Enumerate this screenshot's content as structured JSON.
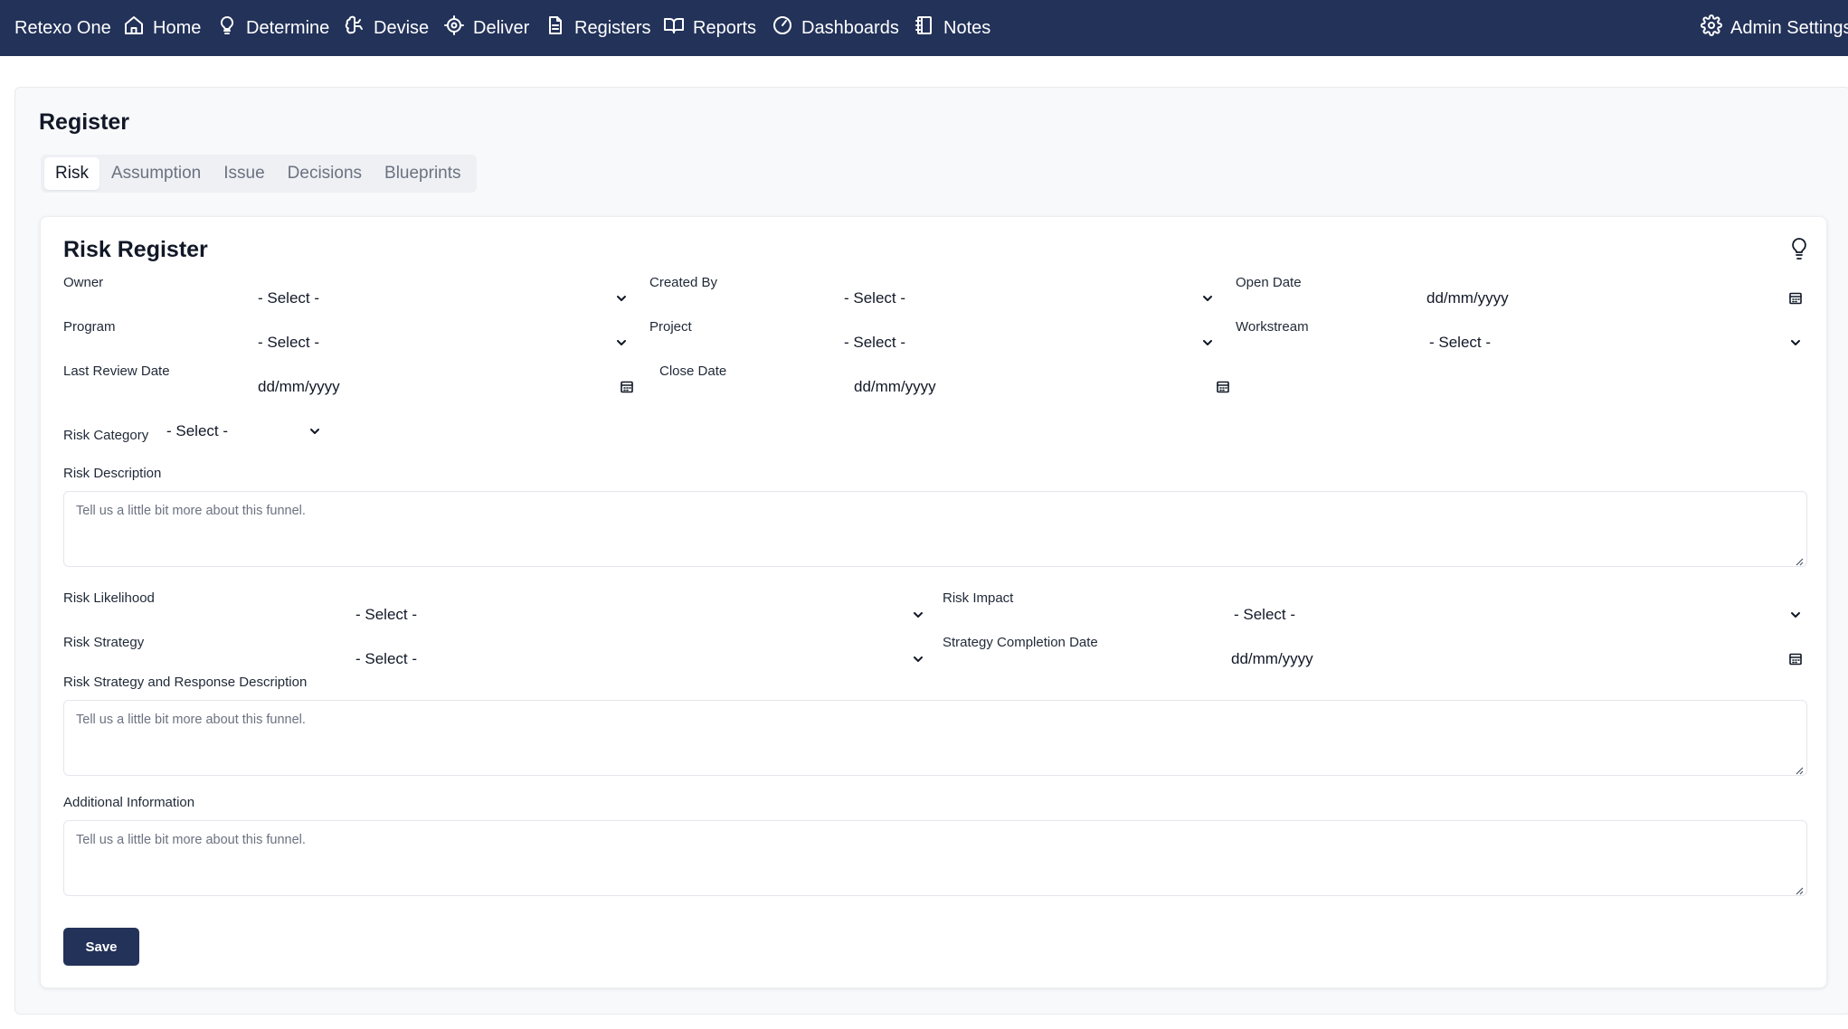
{
  "nav": {
    "brand": "Retexo One",
    "items": [
      {
        "label": "Home",
        "icon": "home-icon"
      },
      {
        "label": "Determine",
        "icon": "lightbulb-icon"
      },
      {
        "label": "Devise",
        "icon": "brain-icon"
      },
      {
        "label": "Deliver",
        "icon": "crosshair-icon"
      },
      {
        "label": "Registers",
        "icon": "document-icon"
      },
      {
        "label": "Reports",
        "icon": "book-open-icon"
      },
      {
        "label": "Dashboards",
        "icon": "gauge-icon"
      },
      {
        "label": "Notes",
        "icon": "notebook-icon"
      }
    ],
    "admin": {
      "label": "Admin Settings",
      "icon": "gear-icon"
    }
  },
  "page": {
    "title": "Register",
    "tabs": [
      {
        "label": "Risk",
        "active": true
      },
      {
        "label": "Assumption",
        "active": false
      },
      {
        "label": "Issue",
        "active": false
      },
      {
        "label": "Decisions",
        "active": false
      },
      {
        "label": "Blueprints",
        "active": false
      }
    ]
  },
  "form": {
    "title": "Risk Register",
    "help_icon": "lightbulb-icon",
    "owner": {
      "label": "Owner",
      "value": "- Select -"
    },
    "created_by": {
      "label": "Created By",
      "value": "- Select -"
    },
    "open_date": {
      "label": "Open Date",
      "value": "dd/mm/yyyy"
    },
    "program": {
      "label": "Program",
      "value": "- Select -"
    },
    "project": {
      "label": "Project",
      "value": "- Select -"
    },
    "workstream": {
      "label": "Workstream",
      "value": "- Select -"
    },
    "last_review_date": {
      "label": "Last Review Date",
      "value": "dd/mm/yyyy"
    },
    "close_date": {
      "label": "Close Date",
      "value": "dd/mm/yyyy"
    },
    "risk_category": {
      "label": "Risk Category",
      "value": "- Select -"
    },
    "risk_description": {
      "label": "Risk Description",
      "placeholder": "Tell us a little bit more about this funnel."
    },
    "risk_likelihood": {
      "label": "Risk Likelihood",
      "value": "- Select -"
    },
    "risk_impact": {
      "label": "Risk Impact",
      "value": "- Select -"
    },
    "risk_strategy": {
      "label": "Risk Strategy",
      "value": "- Select -"
    },
    "strategy_completion_date": {
      "label": "Strategy Completion Date",
      "value": "dd/mm/yyyy"
    },
    "strategy_response_description": {
      "label": "Risk Strategy and Response Description",
      "placeholder": "Tell us a little bit more about this funnel."
    },
    "additional_information": {
      "label": "Additional Information",
      "placeholder": "Tell us a little bit more about this funnel."
    },
    "save_label": "Save"
  },
  "colors": {
    "nav_background": "#233259",
    "primary_button": "#233259",
    "page_background": "#f8f9fb"
  }
}
